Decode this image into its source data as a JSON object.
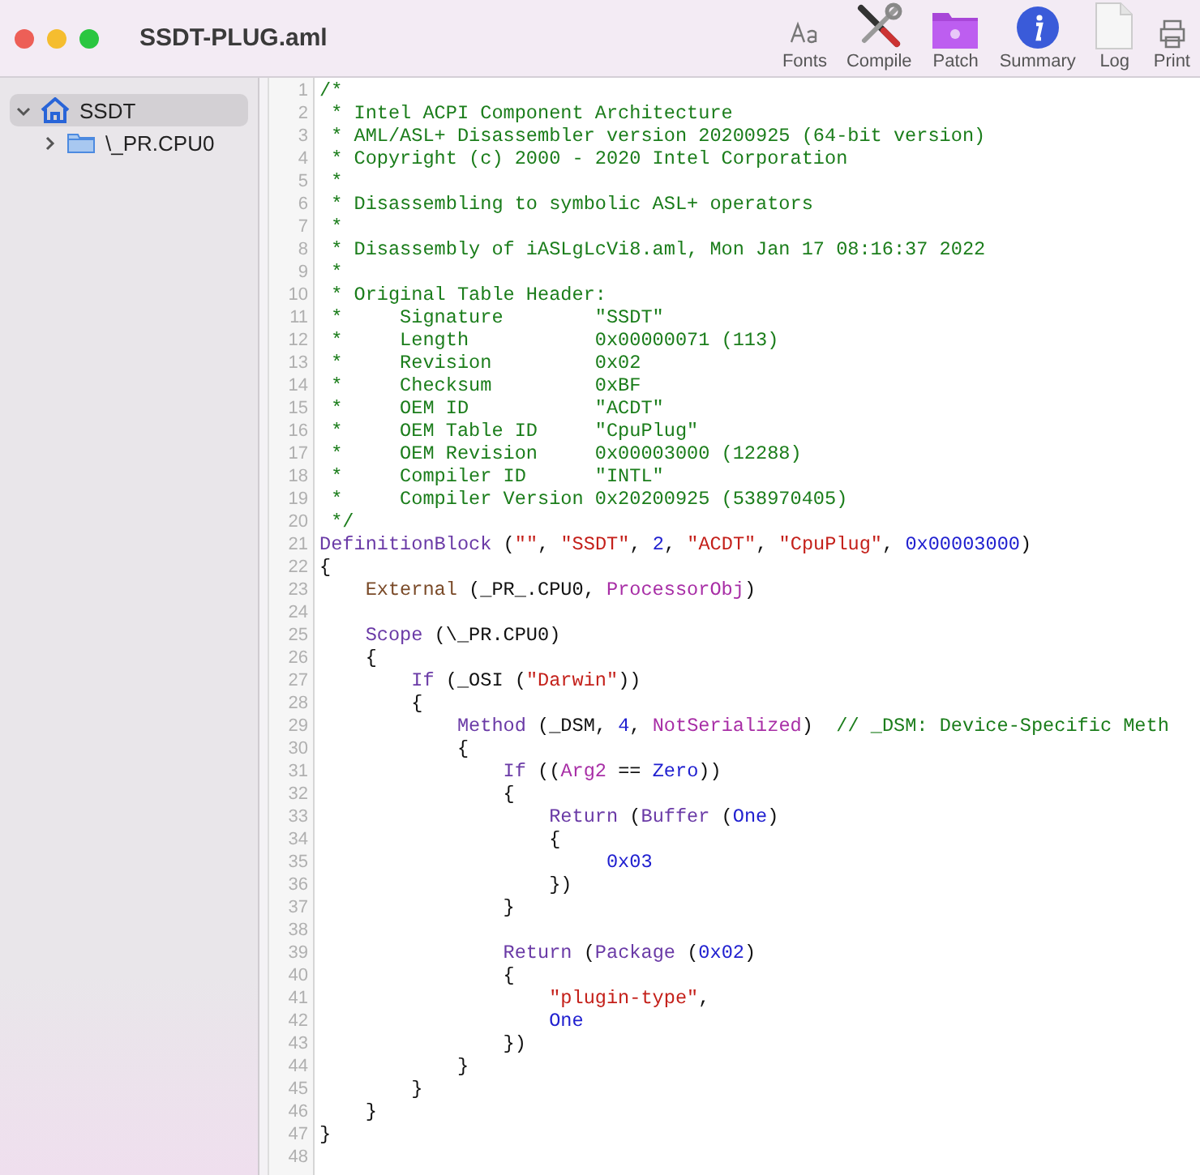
{
  "window": {
    "title": "SSDT-PLUG.aml"
  },
  "toolbar": [
    {
      "kind": "fonts",
      "label": "Fonts"
    },
    {
      "kind": "compile",
      "label": "Compile"
    },
    {
      "kind": "patch",
      "label": "Patch"
    },
    {
      "kind": "summary",
      "label": "Summary"
    },
    {
      "kind": "log",
      "label": "Log"
    },
    {
      "kind": "print",
      "label": "Print"
    }
  ],
  "sidebar": {
    "items": [
      {
        "label": "SSDT",
        "kind": "table",
        "expanded": true,
        "selected": true,
        "children": [
          {
            "label": "\\_PR.CPU0",
            "kind": "scope",
            "expanded": false,
            "selected": false
          }
        ]
      }
    ]
  },
  "editor": {
    "lines": [
      {
        "number": "1",
        "tokens": [
          {
            "kind": "comment",
            "text": "/*"
          }
        ]
      },
      {
        "number": "2",
        "tokens": [
          {
            "kind": "comment",
            "text": " * Intel ACPI Component Architecture"
          }
        ]
      },
      {
        "number": "3",
        "tokens": [
          {
            "kind": "comment",
            "text": " * AML/ASL+ Disassembler version 20200925 (64-bit version)"
          }
        ]
      },
      {
        "number": "4",
        "tokens": [
          {
            "kind": "comment",
            "text": " * Copyright (c) 2000 - 2020 Intel Corporation"
          }
        ]
      },
      {
        "number": "5",
        "tokens": [
          {
            "kind": "comment",
            "text": " *"
          }
        ]
      },
      {
        "number": "6",
        "tokens": [
          {
            "kind": "comment",
            "text": " * Disassembling to symbolic ASL+ operators"
          }
        ]
      },
      {
        "number": "7",
        "tokens": [
          {
            "kind": "comment",
            "text": " *"
          }
        ]
      },
      {
        "number": "8",
        "tokens": [
          {
            "kind": "comment",
            "text": " * Disassembly of iASLgLcVi8.aml, Mon Jan 17 08:16:37 2022"
          }
        ]
      },
      {
        "number": "9",
        "tokens": [
          {
            "kind": "comment",
            "text": " *"
          }
        ]
      },
      {
        "number": "10",
        "tokens": [
          {
            "kind": "comment",
            "text": " * Original Table Header:"
          }
        ]
      },
      {
        "number": "11",
        "tokens": [
          {
            "kind": "comment",
            "text": " *     Signature        \"SSDT\""
          }
        ]
      },
      {
        "number": "12",
        "tokens": [
          {
            "kind": "comment",
            "text": " *     Length           0x00000071 (113)"
          }
        ]
      },
      {
        "number": "13",
        "tokens": [
          {
            "kind": "comment",
            "text": " *     Revision         0x02"
          }
        ]
      },
      {
        "number": "14",
        "tokens": [
          {
            "kind": "comment",
            "text": " *     Checksum         0xBF"
          }
        ]
      },
      {
        "number": "15",
        "tokens": [
          {
            "kind": "comment",
            "text": " *     OEM ID           \"ACDT\""
          }
        ]
      },
      {
        "number": "16",
        "tokens": [
          {
            "kind": "comment",
            "text": " *     OEM Table ID     \"CpuPlug\""
          }
        ]
      },
      {
        "number": "17",
        "tokens": [
          {
            "kind": "comment",
            "text": " *     OEM Revision     0x00003000 (12288)"
          }
        ]
      },
      {
        "number": "18",
        "tokens": [
          {
            "kind": "comment",
            "text": " *     Compiler ID      \"INTL\""
          }
        ]
      },
      {
        "number": "19",
        "tokens": [
          {
            "kind": "comment",
            "text": " *     Compiler Version 0x20200925 (538970405)"
          }
        ]
      },
      {
        "number": "20",
        "tokens": [
          {
            "kind": "comment",
            "text": " */"
          }
        ]
      },
      {
        "number": "21",
        "tokens": [
          {
            "kind": "keyword",
            "text": "DefinitionBlock"
          },
          {
            "kind": "plain",
            "text": " ("
          },
          {
            "kind": "string",
            "text": "\"\""
          },
          {
            "kind": "plain",
            "text": ", "
          },
          {
            "kind": "string",
            "text": "\"SSDT\""
          },
          {
            "kind": "plain",
            "text": ", "
          },
          {
            "kind": "number",
            "text": "2"
          },
          {
            "kind": "plain",
            "text": ", "
          },
          {
            "kind": "string",
            "text": "\"ACDT\""
          },
          {
            "kind": "plain",
            "text": ", "
          },
          {
            "kind": "string",
            "text": "\"CpuPlug\""
          },
          {
            "kind": "plain",
            "text": ", "
          },
          {
            "kind": "number",
            "text": "0x00003000"
          },
          {
            "kind": "plain",
            "text": ")"
          }
        ]
      },
      {
        "number": "22",
        "tokens": [
          {
            "kind": "plain",
            "text": "{"
          }
        ]
      },
      {
        "number": "23",
        "tokens": [
          {
            "kind": "function",
            "text": "    External"
          },
          {
            "kind": "plain",
            "text": " (_PR_.CPU0, "
          },
          {
            "kind": "object",
            "text": "ProcessorObj"
          },
          {
            "kind": "plain",
            "text": ")"
          }
        ]
      },
      {
        "number": "24"
      },
      {
        "number": "25",
        "tokens": [
          {
            "kind": "keyword",
            "text": "    Scope"
          },
          {
            "kind": "plain",
            "text": " (\\_PR.CPU0)"
          }
        ]
      },
      {
        "number": "26",
        "tokens": [
          {
            "kind": "plain",
            "text": "    {"
          }
        ]
      },
      {
        "number": "27",
        "tokens": [
          {
            "kind": "keyword",
            "text": "        If"
          },
          {
            "kind": "plain",
            "text": " (_OSI ("
          },
          {
            "kind": "string",
            "text": "\"Darwin\""
          },
          {
            "kind": "plain",
            "text": "))"
          }
        ]
      },
      {
        "number": "28",
        "tokens": [
          {
            "kind": "plain",
            "text": "        {"
          }
        ]
      },
      {
        "number": "29",
        "tokens": [
          {
            "kind": "keyword",
            "text": "            Method"
          },
          {
            "kind": "plain",
            "text": " (_DSM, "
          },
          {
            "kind": "number",
            "text": "4"
          },
          {
            "kind": "plain",
            "text": ", "
          },
          {
            "kind": "object",
            "text": "NotSerialized"
          },
          {
            "kind": "plain",
            "text": ")  "
          },
          {
            "kind": "comment",
            "text": "// _DSM: Device-Specific Meth"
          }
        ]
      },
      {
        "number": "30",
        "tokens": [
          {
            "kind": "plain",
            "text": "            {"
          }
        ]
      },
      {
        "number": "31",
        "tokens": [
          {
            "kind": "keyword",
            "text": "                If"
          },
          {
            "kind": "plain",
            "text": " (("
          },
          {
            "kind": "object",
            "text": "Arg2"
          },
          {
            "kind": "plain",
            "text": " == "
          },
          {
            "kind": "number",
            "text": "Zero"
          },
          {
            "kind": "plain",
            "text": "))"
          }
        ]
      },
      {
        "number": "32",
        "tokens": [
          {
            "kind": "plain",
            "text": "                {"
          }
        ]
      },
      {
        "number": "33",
        "tokens": [
          {
            "kind": "keyword",
            "text": "                    Return"
          },
          {
            "kind": "plain",
            "text": " ("
          },
          {
            "kind": "keyword",
            "text": "Buffer"
          },
          {
            "kind": "plain",
            "text": " ("
          },
          {
            "kind": "number",
            "text": "One"
          },
          {
            "kind": "plain",
            "text": ")"
          }
        ]
      },
      {
        "number": "34",
        "tokens": [
          {
            "kind": "plain",
            "text": "                    {"
          }
        ]
      },
      {
        "number": "35",
        "tokens": [
          {
            "kind": "number",
            "text": "                         0x03"
          }
        ]
      },
      {
        "number": "36",
        "tokens": [
          {
            "kind": "plain",
            "text": "                    })"
          }
        ]
      },
      {
        "number": "37",
        "tokens": [
          {
            "kind": "plain",
            "text": "                }"
          }
        ]
      },
      {
        "number": "38"
      },
      {
        "number": "39",
        "tokens": [
          {
            "kind": "keyword",
            "text": "                Return"
          },
          {
            "kind": "plain",
            "text": " ("
          },
          {
            "kind": "keyword",
            "text": "Package"
          },
          {
            "kind": "plain",
            "text": " ("
          },
          {
            "kind": "number",
            "text": "0x02"
          },
          {
            "kind": "plain",
            "text": ")"
          }
        ]
      },
      {
        "number": "40",
        "tokens": [
          {
            "kind": "plain",
            "text": "                {"
          }
        ]
      },
      {
        "number": "41",
        "tokens": [
          {
            "kind": "string",
            "text": "                    \"plugin-type\""
          },
          {
            "kind": "plain",
            "text": ","
          }
        ]
      },
      {
        "number": "42",
        "tokens": [
          {
            "kind": "number",
            "text": "                    One"
          }
        ]
      },
      {
        "number": "43",
        "tokens": [
          {
            "kind": "plain",
            "text": "                })"
          }
        ]
      },
      {
        "number": "44",
        "tokens": [
          {
            "kind": "plain",
            "text": "            }"
          }
        ]
      },
      {
        "number": "45",
        "tokens": [
          {
            "kind": "plain",
            "text": "        }"
          }
        ]
      },
      {
        "number": "46",
        "tokens": [
          {
            "kind": "plain",
            "text": "    }"
          }
        ]
      },
      {
        "number": "47",
        "tokens": [
          {
            "kind": "plain",
            "text": "}"
          }
        ]
      },
      {
        "number": "48"
      }
    ]
  }
}
